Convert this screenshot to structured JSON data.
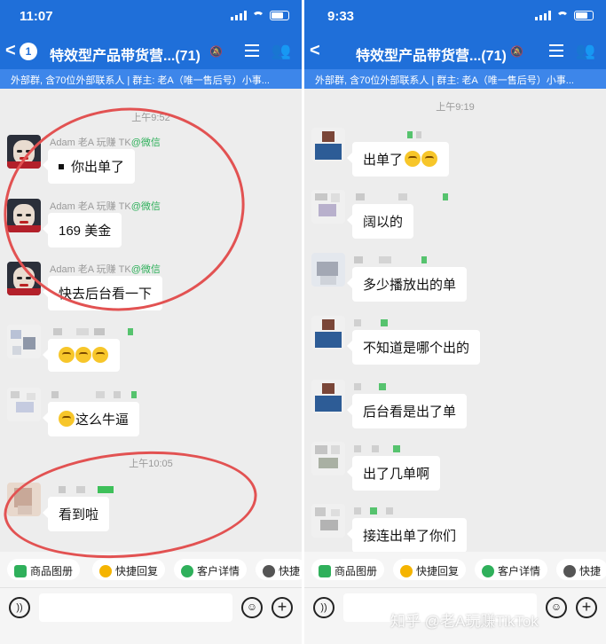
{
  "left": {
    "status": {
      "time": "11:07"
    },
    "nav": {
      "back": "<",
      "unread": "1",
      "title": "特效型产品带货营...(71)"
    },
    "subheader": "外部群, 含70位外部联系人 | 群主: 老A（唯一售后号）小事...",
    "timestamps": [
      "上午9:52",
      "上午10:05"
    ],
    "messages": [
      {
        "sender": "Adam 老A 玩赚 TK",
        "suffix": "@微信",
        "text": "你出单了"
      },
      {
        "sender": "Adam 老A 玩赚 TK",
        "suffix": "@微信",
        "text": "169 美金"
      },
      {
        "sender": "Adam 老A 玩赚 TK",
        "suffix": "@微信",
        "text": "快去后台看一下"
      },
      {
        "text": ""
      },
      {
        "text": "这么牛逼"
      },
      {
        "text": "看到啦"
      }
    ],
    "toolbar": [
      "商品图册",
      "快捷回复",
      "客户详情",
      "快捷"
    ]
  },
  "right": {
    "status": {
      "time": "9:33"
    },
    "nav": {
      "back": "<",
      "title": "特效型产品带货营...(71)"
    },
    "subheader": "外部群, 含70位外部联系人 | 群主: 老A（唯一售后号）小事...",
    "timestamps": [
      "上午9:19"
    ],
    "messages": [
      {
        "text": "出单了"
      },
      {
        "text": "阔以的"
      },
      {
        "text": "多少播放出的单"
      },
      {
        "text": "不知道是哪个出的"
      },
      {
        "text": "后台看是出了单"
      },
      {
        "text": "出了几单啊"
      },
      {
        "text": "接连出单了你们"
      }
    ],
    "toolbar": [
      "商品图册",
      "快捷回复",
      "客户详情",
      "快捷"
    ]
  },
  "watermark": "知乎 @老A玩赚TikTok",
  "colors": {
    "header": "#1f6fd9",
    "subheader": "#3d86ea",
    "annotation": "#e25252",
    "wecom_green": "#2fb05b"
  }
}
